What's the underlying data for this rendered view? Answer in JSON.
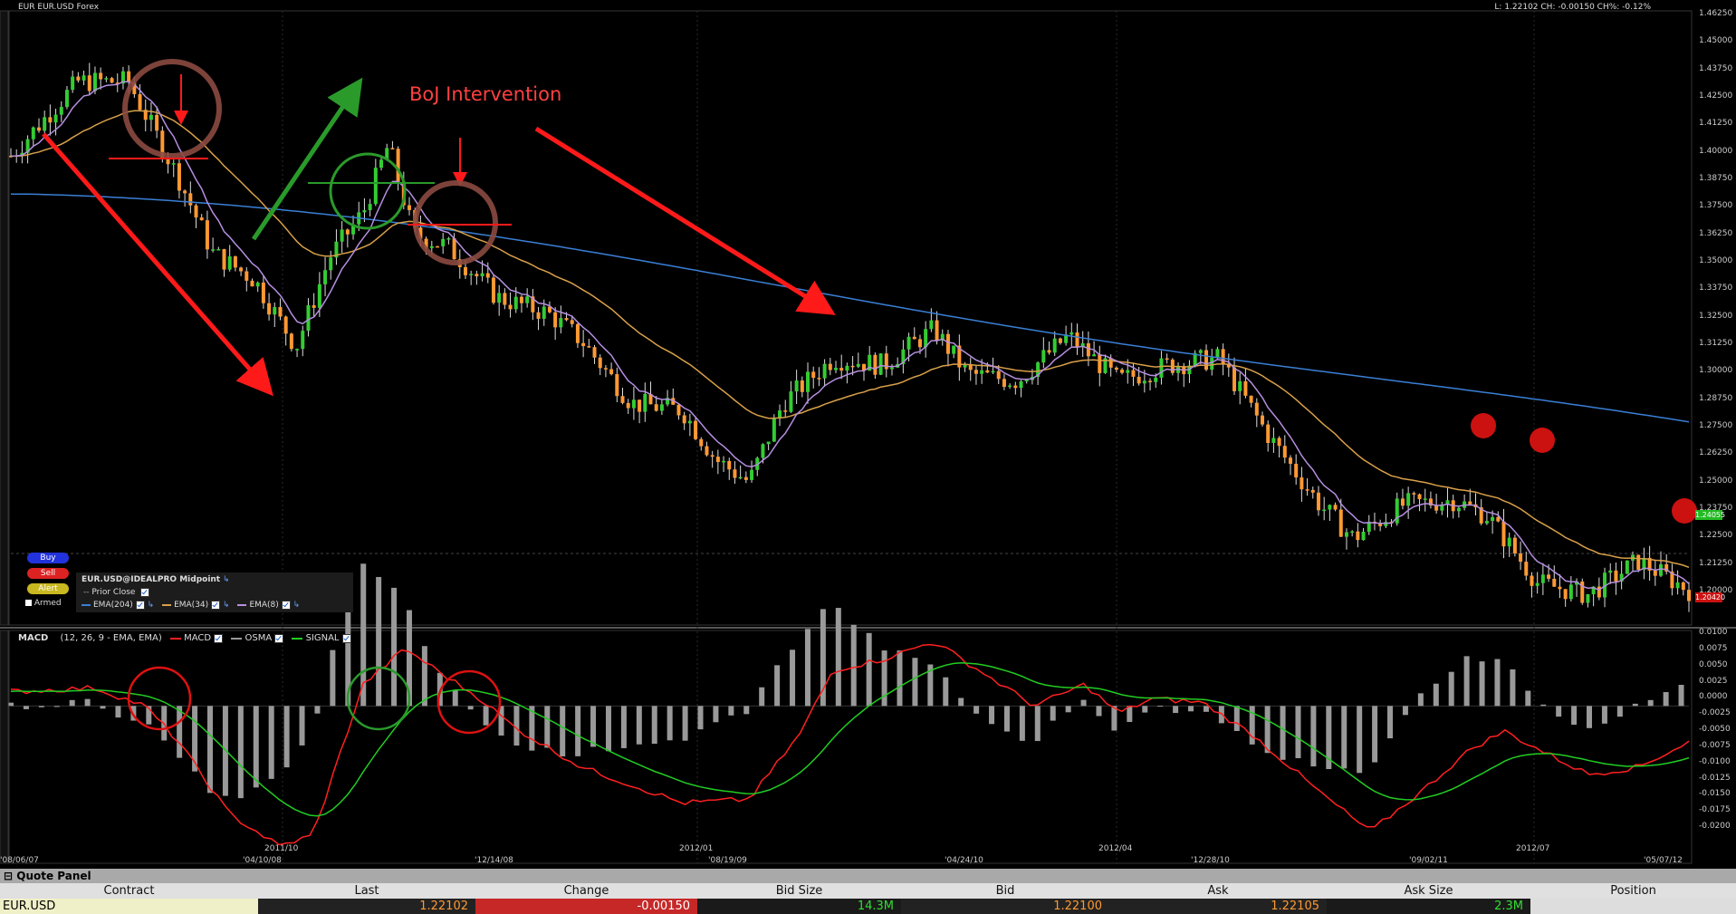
{
  "header": {
    "instrument": "EUR EUR.USD Forex",
    "stats": "L: 1.22102 CH: -0.00150 CH%: -0.12%"
  },
  "annotation": {
    "text": "BoJ Intervention",
    "color": "#ff4040"
  },
  "buttons": {
    "buy": "Buy",
    "sell": "Sell",
    "alert": "Alert",
    "armed": "Armed"
  },
  "legend": {
    "title": "EUR.USD@IDEALPRO Midpoint",
    "prior_close": "Prior Close",
    "ema204": "EMA(204)",
    "ema34": "EMA(34)",
    "ema8": "EMA(8)"
  },
  "price_axis": [
    "1.46250",
    "1.45000",
    "1.43750",
    "1.42500",
    "1.41250",
    "1.40000",
    "1.38750",
    "1.37500",
    "1.36250",
    "1.35000",
    "1.33750",
    "1.32500",
    "1.31250",
    "1.30000",
    "1.28750",
    "1.27500",
    "1.26250",
    "1.25000",
    "1.23750",
    "1.22500",
    "1.21250",
    "1.20000"
  ],
  "price_badges": {
    "last": "1.24055",
    "low": "1.20420"
  },
  "macd_legend": {
    "title": "MACD",
    "params": "(12, 26, 9 - EMA, EMA)",
    "macd": "MACD",
    "osma": "OSMA",
    "signal": "SIGNAL"
  },
  "macd_axis": [
    "0.0100",
    "0.0075",
    "0.0050",
    "0.0025",
    "0.0000",
    "-0.0025",
    "-0.0050",
    "-0.0075",
    "-0.0100",
    "-0.0125",
    "-0.0150",
    "-0.0175",
    "-0.0200"
  ],
  "date_axis": {
    "top": [
      "2011/10",
      "2012/01",
      "2012/04",
      "2012/07"
    ],
    "bottom": [
      "'08/06/07",
      "'04/10/08",
      "'12/14/08",
      "'08/19/09",
      "'04/24/10",
      "'12/28/10",
      "'09/02/11",
      "'05/07/12"
    ]
  },
  "colors": {
    "up": "#33cc33",
    "down": "#ff9933",
    "ema204": "#3a7fd5",
    "ema34": "#d9a04a",
    "ema8": "#b58fe0",
    "macd": "#ff2020",
    "signal": "#22cc22",
    "osma": "#999999"
  },
  "quote_panel": {
    "title": "Quote Panel",
    "columns": [
      "Contract",
      "Last",
      "Change",
      "Bid Size",
      "Bid",
      "Ask",
      "Ask Size",
      "Position"
    ],
    "row": {
      "contract": "EUR.USD",
      "last": "1.22102",
      "change": "-0.00150",
      "bid_size": "14.3M",
      "bid": "1.22100",
      "ask": "1.22105",
      "ask_size": "2.3M",
      "position": ""
    }
  }
}
